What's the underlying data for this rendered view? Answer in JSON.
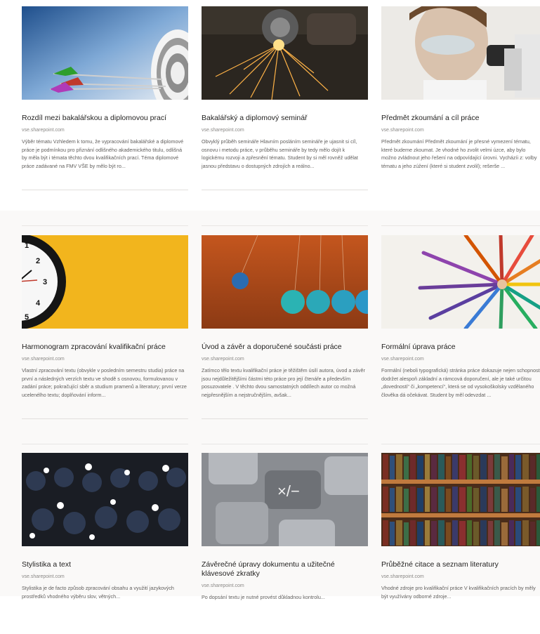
{
  "source": "vse.sharepoint.com",
  "cards": [
    {
      "title": "Rozdíl mezi bakalářskou a diplomovou prací",
      "desc": "Výběr tématu Vzhledem k tomu, že vypracování bakalářské a diplomové práce je podmínkou pro přiznání odlišného akademického titulu, odlišná by měla být i témata těchto dvou kvalifikačních prací. Téma diplomové práce zadávané na FMV VŠE by mělo být ro..."
    },
    {
      "title": "Bakalářský a diplomový seminář",
      "desc": "Obvyklý průběh semináře Hlavním posláním semináře je ujasnit si cíl, osnovu i metodu práce, v průběhu semináře by tedy mělo dojít k logickému rozvoji a zpřesnění tématu. Student by si měl rovněž udělat jasnou představu o dostupných zdrojích a reálno..."
    },
    {
      "title": "Předmět zkoumání a cíl práce",
      "desc": "Předmět zkoumání Předmět zkoumání je přesné vymezení tématu, které budeme zkoumat. Je vhodné ho zvolit velmi úzce, aby bylo možno zvládnout jeho řešení na odpovídající úrovni. Vycházíi z: volby tématu a jeho zúžení (které si student zvolil); rešerše ..."
    },
    {
      "title": "Harmonogram zpracování kvalifikační práce",
      "desc": "Vlastní zpracování textu (obvykle v posledním semestru studia) práce na první a následných verzích textu ve shodě s osnovou, formulovanou v zadání práce; pokračující sběr a studium pramenů a literatury; první verze ucelenélho textu; doplňování inform..."
    },
    {
      "title": "Úvod a závěr a doporučené součásti práce",
      "desc": "Zatímco tělo textu kvalifikační práce je těžištěm úsilí autora, úvod a závěr jsou nejdůležitějšími částmi této práce pro její čtenáře a především posuzovatele . V těchto dvou samostatných oddílech autor co možná nejpřesnějším a nejstručnějším, avšak..."
    },
    {
      "title": "Formální úprava práce",
      "desc": "Formální (neboli typografická) stránka práce dokazuje nejen schopnost dodržet alespoň základní a rámcová doporučení, ale je také určitou „dovedností“ či „kompetencí“, která se od vysokoškolsky vzdělaného člověka dá očekávat. Student by měl odevzdat ..."
    },
    {
      "title": "Stylistika a text",
      "desc": "Stylistika je de facto způsob zpracování obsahu a využití jazykových prostředků vhodného výběru slov, větných..."
    },
    {
      "title": "Závěrečné úpravy dokumentu a užitečné klávesové zkratky",
      "desc": "Po dopsání textu je nutné provést důkladnou kontrolu..."
    },
    {
      "title": "Průběžné citace a seznam literatury",
      "desc": "Vhodné zdroje pro kvalifikační práce V kvalifikačních pracích by měly být využívány odborné zdroje..."
    }
  ],
  "images": [
    "target-arrows-image",
    "grinder-sparks-image",
    "microscope-scientist-image",
    "clock-yellow-image",
    "newtons-cradle-image",
    "colored-pencils-image",
    "photographers-crowd-image",
    "calculator-keys-image",
    "bookshelf-image"
  ]
}
